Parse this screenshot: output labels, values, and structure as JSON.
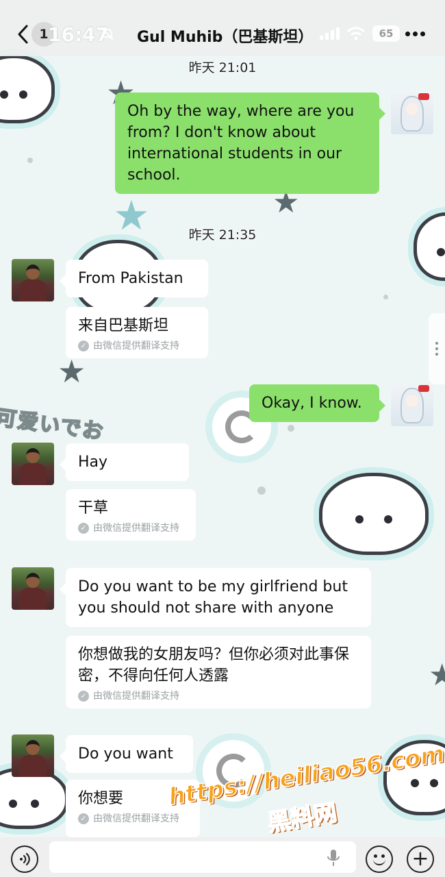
{
  "status_bar": {
    "time": "16:47",
    "battery": "65"
  },
  "header": {
    "unread_badge": "1",
    "title": "Gul Muhib（巴基斯坦）"
  },
  "messages": [
    {
      "type": "timestamp",
      "text": "昨天 21:01"
    },
    {
      "type": "outgoing",
      "text": "Oh by the way, where are you from? I don't know about international students in our school."
    },
    {
      "type": "timestamp",
      "text": "昨天 21:35"
    },
    {
      "type": "incoming",
      "text": "From Pakistan",
      "translation": "来自巴基斯坦"
    },
    {
      "type": "outgoing",
      "text": "Okay, I know."
    },
    {
      "type": "incoming",
      "text": "Hay",
      "translation": "干草"
    },
    {
      "type": "incoming",
      "text": "Do you want to be my girlfriend but you should not share with anyone",
      "translation": "你想做我的女朋友吗？但你必须对此事保密，不得向任何人透露"
    },
    {
      "type": "incoming",
      "text": "Do you want",
      "translation": "你想要"
    }
  ],
  "translation_note": "由微信提供翻译支持",
  "watermark": {
    "url": "https://heiliao56.com",
    "text": "黑料网"
  },
  "background": {
    "kawaii_text": "可爱いでお"
  },
  "colors": {
    "outgoing_bubble": "#8be06b",
    "incoming_bubble": "#ffffff",
    "watermark": "#f5a623"
  }
}
